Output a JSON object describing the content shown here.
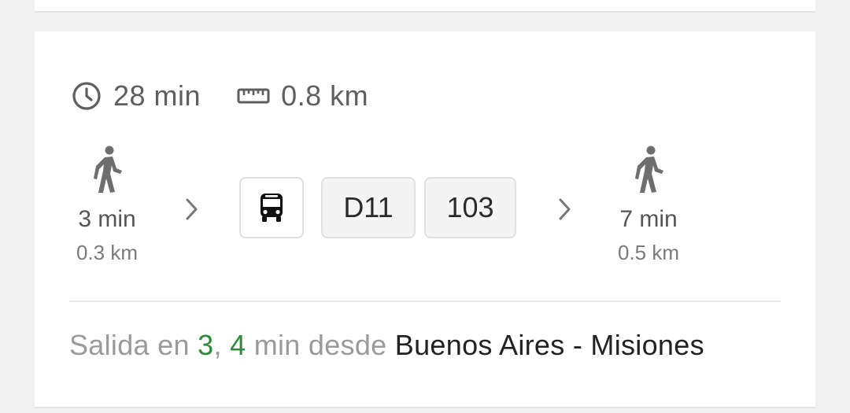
{
  "summary": {
    "duration": "28 min",
    "distance": "0.8 km",
    "clock_icon": "clock-icon",
    "ruler_icon": "ruler-icon"
  },
  "walk_start": {
    "time": "3 min",
    "distance": "0.3 km",
    "icon": "walking-person-icon"
  },
  "transit": {
    "bus_icon": "bus-icon",
    "routes": [
      "D11",
      "103"
    ]
  },
  "walk_end": {
    "time": "7 min",
    "distance": "0.5 km",
    "icon": "walking-person-icon"
  },
  "departure": {
    "prefix": "Salida en ",
    "time1": "3",
    "sep": ", ",
    "time2": "4",
    "middle": " min desde ",
    "stop": "Buenos Aires - Misiones"
  },
  "colors": {
    "departure_time": "#2e8b3a",
    "background": "#f1f1f1",
    "card": "#ffffff"
  }
}
